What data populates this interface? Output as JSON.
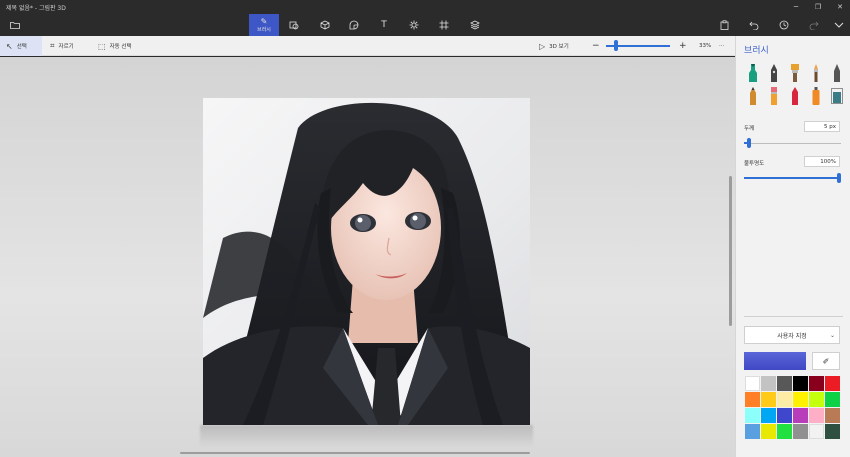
{
  "window": {
    "title": "제목 없음* - 그림판 3D",
    "minimize": "─",
    "maximize": "❐",
    "close": "✕"
  },
  "toolbar": {
    "brushes_label": "브러시",
    "icons": [
      "folder-icon",
      "brush-icon",
      "shapes-2d-icon",
      "shapes-3d-icon",
      "stickers-icon",
      "text-icon",
      "effects-icon",
      "canvas-icon",
      "library-icon",
      "paste-icon",
      "undo-icon",
      "history-icon",
      "redo-icon",
      "expand-icon"
    ]
  },
  "subbar": {
    "select_label": "선택",
    "crop_label": "자르기",
    "magic_select_label": "자동 선택",
    "view3d_label": "3D 보기",
    "zoom_minus": "−",
    "zoom_plus": "+",
    "zoom_value": "33%",
    "more": "···",
    "zoom_level": 0.12
  },
  "panel": {
    "title": "브러시",
    "thickness_label": "두께",
    "thickness_value": "5 px",
    "thickness_level": 0.05,
    "opacity_label": "불투명도",
    "opacity_value": "100%",
    "opacity_level": 1.0,
    "color_mode": "사용자 지정",
    "current_color": "#4048c4",
    "brush_colors": [
      "#1a9f80",
      "#333333",
      "#e0a030",
      "#f1a24a",
      "#555555",
      "#333333",
      "#e86a7a",
      "#d7263d",
      "#f08a24",
      "#3b7d86"
    ],
    "swatches": [
      "#ffffff",
      "#c3c3c3",
      "#585858",
      "#000000",
      "#88001b",
      "#ec1c24",
      "#ff7f27",
      "#ffca18",
      "#fdeca6",
      "#fff200",
      "#c4ff0e",
      "#0ed145",
      "#8cfffb",
      "#00a8f3",
      "#3f48cc",
      "#b83dba",
      "#ffaec8",
      "#b97a56",
      "#5aa0e0",
      "#e8e800",
      "#22e040",
      "#909090",
      "#f2f2f2",
      "#2f4f40"
    ]
  }
}
